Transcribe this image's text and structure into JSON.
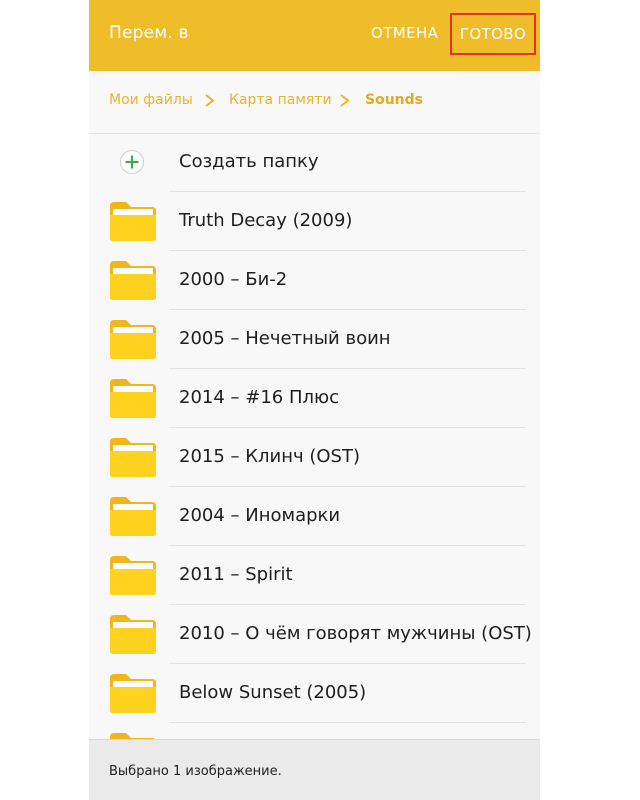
{
  "header": {
    "title": "Перем. в",
    "cancel_label": "ОТМЕНА",
    "done_label": "ГОТОВО"
  },
  "breadcrumb": [
    {
      "label": "Мои файлы"
    },
    {
      "label": "Карта памяти"
    },
    {
      "label": "Sounds"
    }
  ],
  "create_folder": {
    "label": "Создать папку",
    "icon": "plus-circle-icon"
  },
  "folders": [
    {
      "name": "Truth Decay (2009)"
    },
    {
      "name": "2000 – Би-2"
    },
    {
      "name": "2005 – Нечетный воин"
    },
    {
      "name": "2014 – #16 Плюс"
    },
    {
      "name": "2015 – Клинч (OST)"
    },
    {
      "name": "2004 – Иномарки"
    },
    {
      "name": "2011 – Spirit"
    },
    {
      "name": "2010 – О чём говорят мужчины (OST)"
    },
    {
      "name": "Below Sunset (2005)"
    }
  ],
  "footer": {
    "status": "Выбрано 1 изображение."
  },
  "colors": {
    "accent": "#f0bd2a",
    "breadcrumb": "#e9b52b",
    "highlight_border": "#e63027",
    "folder": "#ffd21f",
    "plus": "#3aa757"
  }
}
